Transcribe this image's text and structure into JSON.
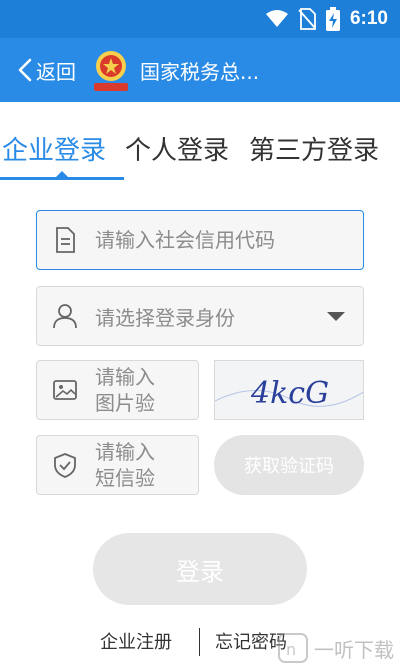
{
  "status_bar": {
    "time": "6:10",
    "icons": [
      "wifi-icon",
      "no-sim-icon",
      "battery-charging-icon"
    ]
  },
  "app_bar": {
    "back_label": "返回",
    "title": "国家税务总...",
    "emblem_icon": "tax-emblem-icon"
  },
  "tabs": [
    {
      "label": "企业登录",
      "active": true
    },
    {
      "label": "个人登录",
      "active": false
    },
    {
      "label": "第三方登录",
      "active": false
    }
  ],
  "form": {
    "credit_code_placeholder": "请输入社会信用代码",
    "identity_placeholder": "请选择登录身份",
    "image_captcha_placeholder": "请输入图片验",
    "sms_code_placeholder": "请输入短信验",
    "captcha_text": "4kcG",
    "sms_button_label": "获取验证码",
    "login_button_label": "登录"
  },
  "footer": {
    "register_label": "企业注册",
    "forgot_label": "忘记密码"
  },
  "watermark": {
    "text": "一听下载"
  },
  "colors": {
    "primary": "#2a8be6",
    "status_bar": "#1e7fd8",
    "disabled_button": "#e6e6e6",
    "field_border": "#d9d9d9",
    "placeholder": "#8c8c8c"
  }
}
